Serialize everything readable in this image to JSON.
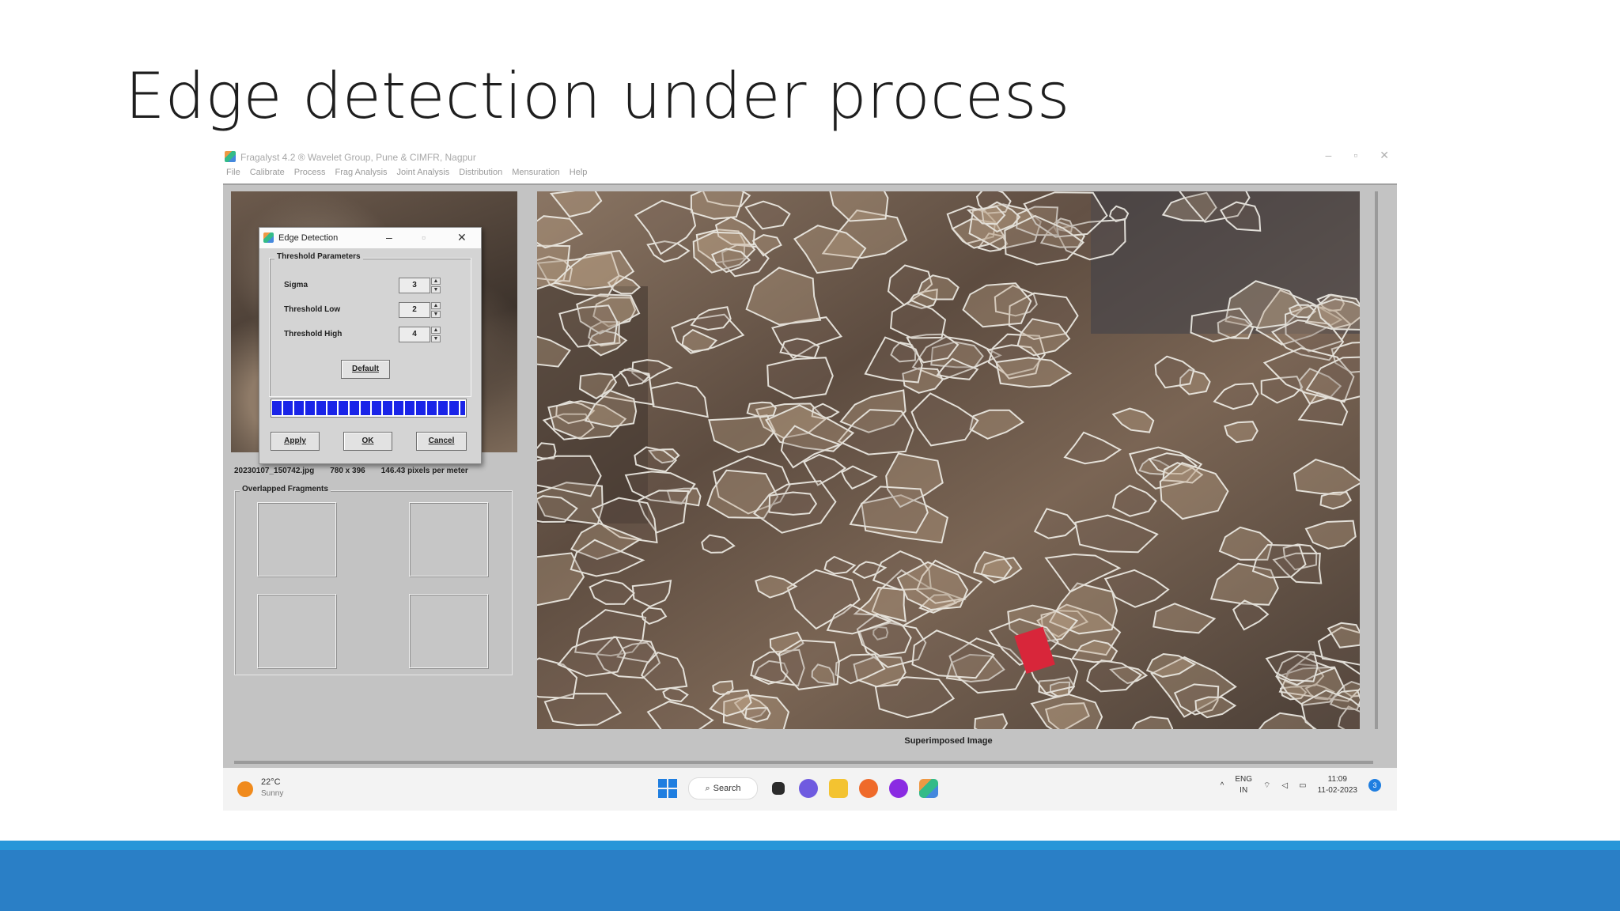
{
  "slide": {
    "title": "Edge detection under process"
  },
  "window": {
    "title": "Fragalyst 4.2 ® Wavelet Group, Pune & CIMFR, Nagpur",
    "controls": {
      "minimize": "–",
      "restore": "▫",
      "close": "✕"
    },
    "menu": [
      "File",
      "Calibrate",
      "Process",
      "Frag Analysis",
      "Joint Analysis",
      "Distribution",
      "Mensuration",
      "Help"
    ]
  },
  "left_panel": {
    "file_name": "20230107_150742.jpg",
    "dimensions": "780 x 396",
    "scale": "146.43 pixels per meter",
    "fragments_group": "Overlapped Fragments"
  },
  "main": {
    "caption": "Superimposed Image"
  },
  "dialog": {
    "title": "Edge Detection",
    "controls": {
      "minimize": "–",
      "maximize": "▫",
      "close": "✕"
    },
    "group_label": "Threshold Parameters",
    "params": [
      {
        "label": "Sigma",
        "value": "3"
      },
      {
        "label": "Threshold Low",
        "value": "2"
      },
      {
        "label": "Threshold High",
        "value": "4"
      }
    ],
    "default_button": "Default",
    "progress_fraction": 1.0,
    "buttons": {
      "apply": "Apply",
      "ok": "OK",
      "cancel": "Cancel"
    }
  },
  "taskbar": {
    "weather_temp": "22°C",
    "weather_desc": "Sunny",
    "search_label": "Search",
    "lang_top": "ENG",
    "lang_bottom": "IN",
    "time": "11:09",
    "date": "11-02-2023",
    "notification_count": "3"
  },
  "colors": {
    "band": "#2a7fc6",
    "progress": "#1a24e8",
    "window_bg": "#c3c3c3"
  }
}
